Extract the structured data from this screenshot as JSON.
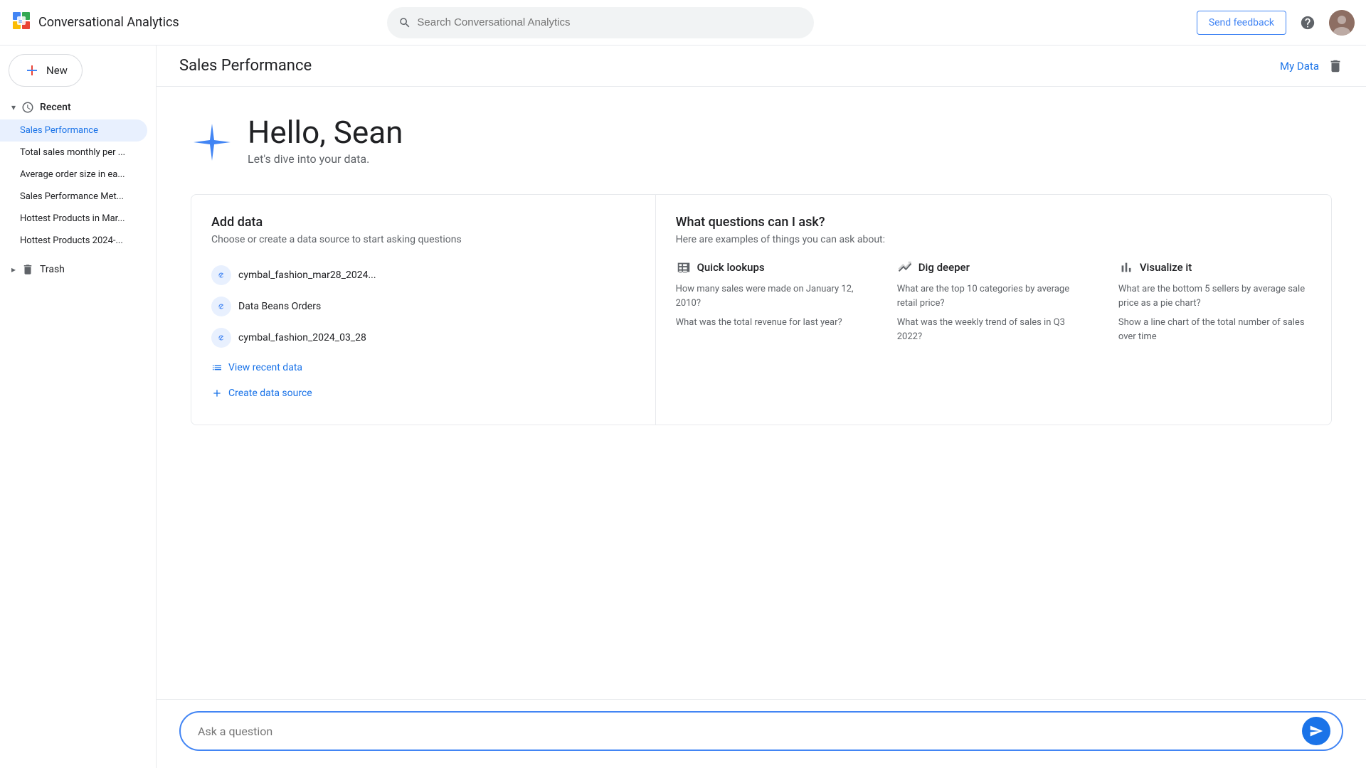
{
  "topnav": {
    "logo_label": "Conversational Analytics",
    "search_placeholder": "Search Conversational Analytics",
    "send_feedback_label": "Send feedback"
  },
  "sidebar": {
    "new_label": "New",
    "recent_label": "Recent",
    "trash_label": "Trash",
    "items": [
      {
        "id": "sales-performance",
        "label": "Sales Performance",
        "active": true
      },
      {
        "id": "total-sales",
        "label": "Total sales monthly per ..."
      },
      {
        "id": "avg-order",
        "label": "Average order size in ea..."
      },
      {
        "id": "sales-met",
        "label": "Sales Performance Met..."
      },
      {
        "id": "hottest-mar",
        "label": "Hottest Products in Mar..."
      },
      {
        "id": "hottest-2024",
        "label": "Hottest Products 2024-..."
      }
    ]
  },
  "page_header": {
    "title": "Sales Performance",
    "my_data_label": "My Data",
    "delete_tooltip": "Delete"
  },
  "welcome": {
    "greeting": "Hello, Sean",
    "subtitle": "Let's dive into your data."
  },
  "add_data": {
    "title": "Add data",
    "subtitle": "Choose or create a data source to start asking questions",
    "items": [
      {
        "id": "cymbal1",
        "label": "cymbal_fashion_mar28_2024..."
      },
      {
        "id": "databeans",
        "label": "Data Beans Orders"
      },
      {
        "id": "cymbal2",
        "label": "cymbal_fashion_2024_03_28"
      }
    ],
    "view_recent_label": "View recent data",
    "create_source_label": "Create data source"
  },
  "questions": {
    "title": "What questions can I ask?",
    "subtitle": "Here are examples of things you can ask about:",
    "columns": [
      {
        "id": "quick-lookups",
        "title": "Quick lookups",
        "icon": "table-icon",
        "items": [
          "How many sales were made on January 12, 2010?",
          "What was the total revenue for last year?"
        ]
      },
      {
        "id": "dig-deeper",
        "title": "Dig deeper",
        "icon": "chart-line-icon",
        "items": [
          "What are the top 10 categories by average retail price?",
          "What was the weekly trend of sales in Q3 2022?"
        ]
      },
      {
        "id": "visualize-it",
        "title": "Visualize it",
        "icon": "bar-chart-icon",
        "items": [
          "What are the bottom 5 sellers by average sale price as a pie chart?",
          "Show a line chart of the total number of sales over time"
        ]
      }
    ]
  },
  "ask_bar": {
    "placeholder": "Ask a question"
  }
}
